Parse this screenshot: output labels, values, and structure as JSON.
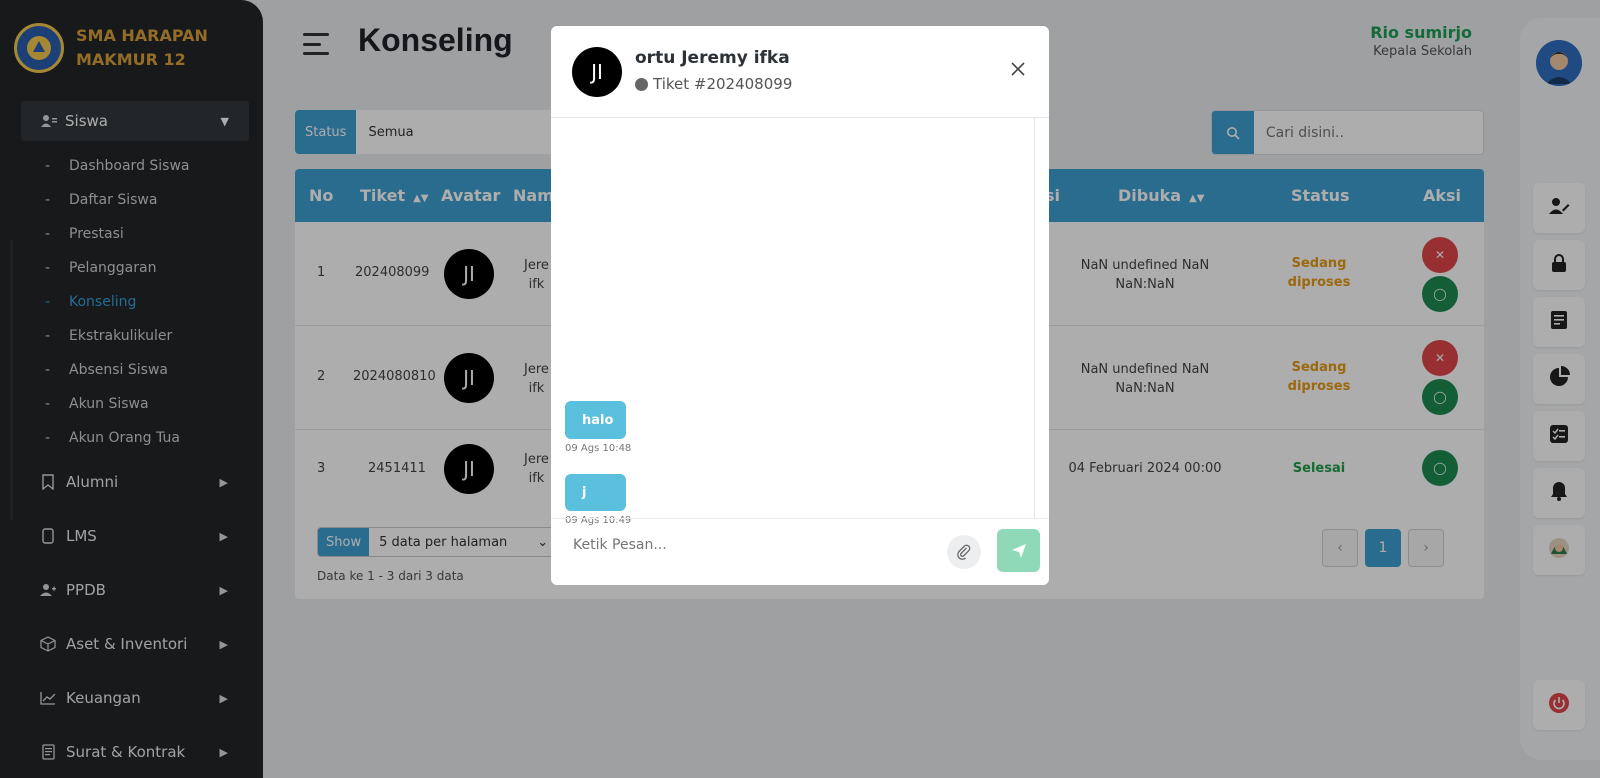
{
  "brand": {
    "name_line1": "SMA HARAPAN",
    "name_line2": "MAKMUR 12"
  },
  "sidebar": {
    "group": {
      "label": "Siswa",
      "icon": "user-list-icon"
    },
    "subitems": [
      {
        "label": "Dashboard Siswa",
        "active": false
      },
      {
        "label": "Daftar Siswa",
        "active": false
      },
      {
        "label": "Prestasi",
        "active": false
      },
      {
        "label": "Pelanggaran",
        "active": false
      },
      {
        "label": "Konseling",
        "active": true
      },
      {
        "label": "Ekstrakulikuler",
        "active": false
      },
      {
        "label": "Absensi Siswa",
        "active": false
      },
      {
        "label": "Akun Siswa",
        "active": false
      },
      {
        "label": "Akun Orang Tua",
        "active": false
      }
    ],
    "items": [
      {
        "label": "Alumni",
        "icon": "bookmark-icon"
      },
      {
        "label": "LMS",
        "icon": "tablet-icon"
      },
      {
        "label": "PPDB",
        "icon": "user-add-icon"
      },
      {
        "label": "Aset & Inventori",
        "icon": "box-icon"
      },
      {
        "label": "Keuangan",
        "icon": "chart-line-icon"
      },
      {
        "label": "Surat & Kontrak",
        "icon": "document-icon"
      }
    ]
  },
  "header": {
    "title": "Konseling",
    "user_name": "Rio sumirjo",
    "user_role": "Kepala Sekolah"
  },
  "filter": {
    "label": "Status",
    "value": "Semua"
  },
  "search": {
    "placeholder": "Cari disini.."
  },
  "table": {
    "headers": {
      "no": "No",
      "tiket": "Tiket",
      "avatar": "Avatar",
      "nama": "Nam",
      "kategori": "si",
      "dibuka": "Dibuka",
      "status": "Status",
      "aksi": "Aksi"
    },
    "rows": [
      {
        "no": "1",
        "tiket": "202408099",
        "avatar": "JI",
        "nama_line1": "Jere",
        "nama_line2": "ifk",
        "dibuka_line1": "NaN undefined NaN",
        "dibuka_line2": "NaN:NaN",
        "status_line1": "Sedang",
        "status_line2": "diproses",
        "status_color": "#e59a12"
      },
      {
        "no": "2",
        "tiket": "2024080810",
        "avatar": "JI",
        "nama_line1": "Jere",
        "nama_line2": "ifk",
        "dibuka_line1": "NaN undefined NaN",
        "dibuka_line2": "NaN:NaN",
        "status_line1": "Sedang",
        "status_line2": "diproses",
        "status_color": "#e59a12"
      },
      {
        "no": "3",
        "tiket": "2451411",
        "avatar": "JI",
        "nama_line1": "Jere",
        "nama_line2": "ifk",
        "dibuka_line1": "04 Februari 2024 00:00",
        "dibuka_line2": "",
        "status_line1": "Selesai",
        "status_line2": "",
        "status_color": "#1f9d4a"
      }
    ]
  },
  "footer": {
    "show_label": "Show",
    "show_value": "5 data per halaman",
    "info": "Data ke 1 - 3 dari 3 data",
    "current_page": "1",
    "prev": "‹",
    "next": "›"
  },
  "modal": {
    "avatar": "JI",
    "name": "ortu Jeremy ifka",
    "ticket": "Tiket #202408099",
    "messages": [
      {
        "text": "halo",
        "time": "09 Ags 10:48"
      },
      {
        "text": "j",
        "time": "09 Ags 10:49"
      }
    ],
    "input_placeholder": "Ketik Pesan..."
  },
  "colors": {
    "primary": "#3d9fd1",
    "sidebar_bg": "#222628",
    "pending": "#e59a12",
    "done": "#1f9d4a",
    "danger": "#e0464b",
    "success": "#1c8a52"
  }
}
